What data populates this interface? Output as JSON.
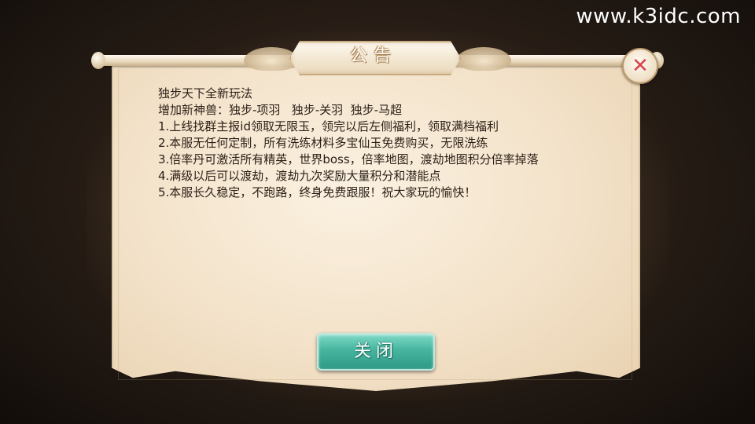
{
  "watermark": "www.k3idc.com",
  "dialog": {
    "title": "公告",
    "close_icon": "close-x-icon",
    "lines": [
      "独步天下全新玩法",
      "增加新神兽：独步-项羽   独步-关羽  独步-马超",
      "1.上线找群主报id领取无限玉，领完以后左侧福利，领取满档福利",
      "2.本服无任何定制，所有洗练材料多宝仙玉免费购买，无限洗练",
      "3.倍率丹可激活所有精英，世界boss，倍率地图，渡劫地图积分倍率掉落",
      "4.满级以后可以渡劫，渡劫九次奖励大量积分和潜能点",
      "5.本服长久稳定，不跑路，终身免费跟服！祝大家玩的愉快！"
    ],
    "button_label": "关闭"
  },
  "colors": {
    "parchment": "#f3e2c9",
    "button_teal": "#45b59f",
    "close_red": "#d9434b",
    "text": "#2b1f17"
  }
}
